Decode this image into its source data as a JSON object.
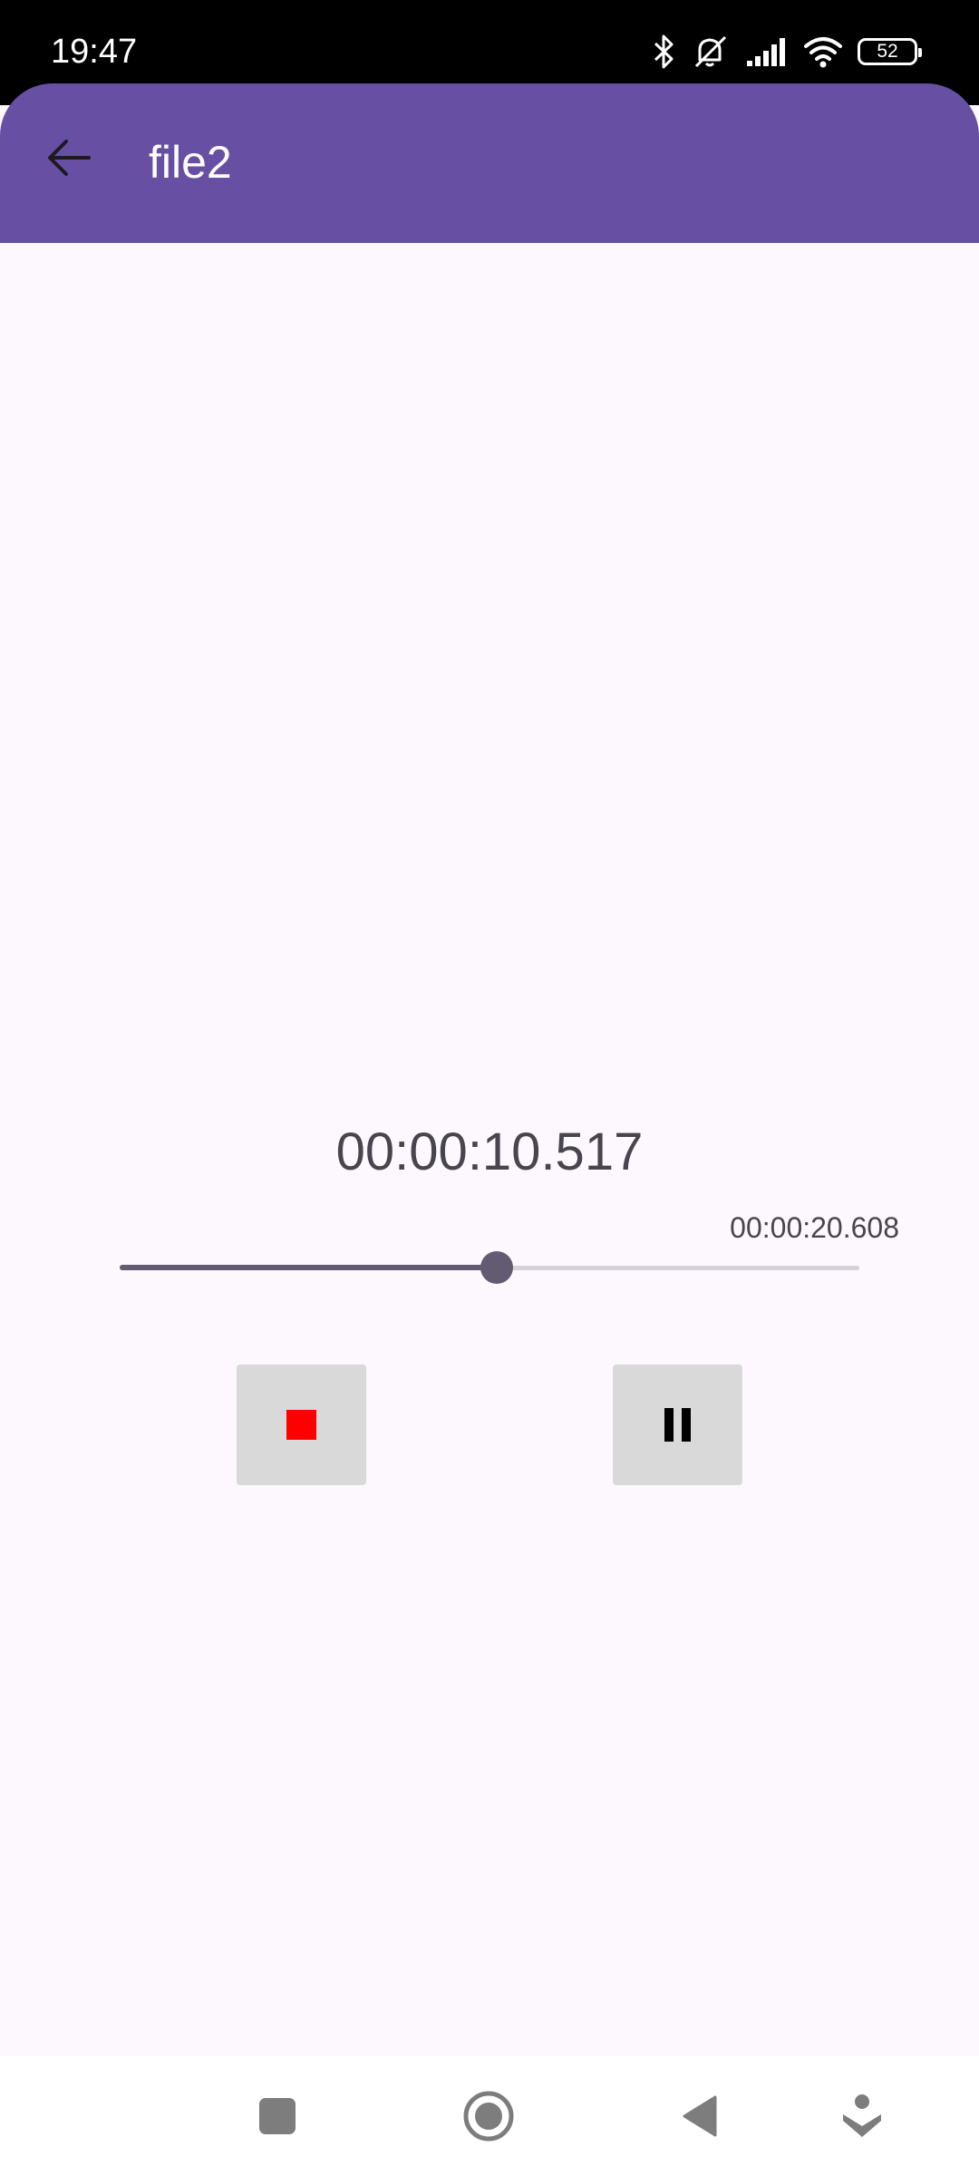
{
  "status_bar": {
    "time": "19:47",
    "battery_level": "52",
    "icons": [
      "bluetooth-icon",
      "silent-mode-icon",
      "signal-icon",
      "wifi-icon",
      "battery-icon"
    ]
  },
  "app_bar": {
    "title": "file2",
    "back_icon": "arrow-back-icon",
    "color": "#6750a4"
  },
  "player": {
    "elapsed": "00:00:10.517",
    "total": "00:00:20.608",
    "progress_fraction": 0.51,
    "stop_icon": "stop-icon",
    "stop_color": "#ff0000",
    "pause_icon": "pause-icon"
  },
  "nav_bar": {
    "buttons": [
      "recents-square-icon",
      "home-circle-icon",
      "back-triangle-icon",
      "assistant-icon"
    ]
  }
}
